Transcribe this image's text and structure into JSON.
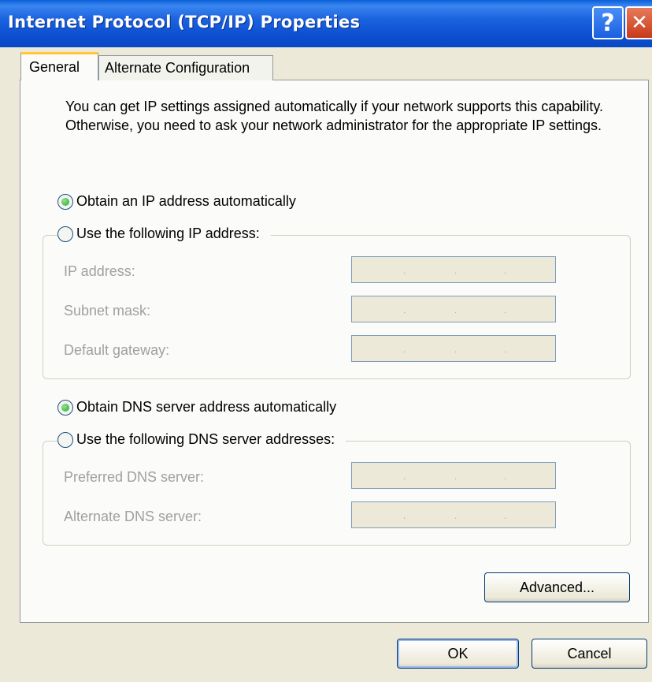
{
  "window": {
    "title": "Internet Protocol (TCP/IP) Properties",
    "help_glyph": "?",
    "close_glyph": "✕"
  },
  "tabs": [
    {
      "label": "General",
      "active": true
    },
    {
      "label": "Alternate Configuration",
      "active": false
    }
  ],
  "intro_text": "You can get IP settings assigned automatically if your network supports this capability. Otherwise, you need to ask your network administrator for the appropriate IP settings.",
  "ip_section": {
    "auto_label": "Obtain an IP address automatically",
    "manual_label": "Use the following IP address:",
    "selected": "auto",
    "fields": [
      {
        "label": "IP address:",
        "value": ""
      },
      {
        "label": "Subnet mask:",
        "value": ""
      },
      {
        "label": "Default gateway:",
        "value": ""
      }
    ]
  },
  "dns_section": {
    "auto_label": "Obtain DNS server address automatically",
    "manual_label": "Use the following DNS server addresses:",
    "selected": "auto",
    "fields": [
      {
        "label": "Preferred DNS server:",
        "value": ""
      },
      {
        "label": "Alternate DNS server:",
        "value": ""
      }
    ]
  },
  "buttons": {
    "advanced": "Advanced...",
    "ok": "OK",
    "cancel": "Cancel"
  },
  "colors": {
    "titlebar": "#0a48c4",
    "dialog_bg": "#ece9d8",
    "radio_selected": "#2aa52a",
    "active_tab_accent": "#ffc83c"
  }
}
